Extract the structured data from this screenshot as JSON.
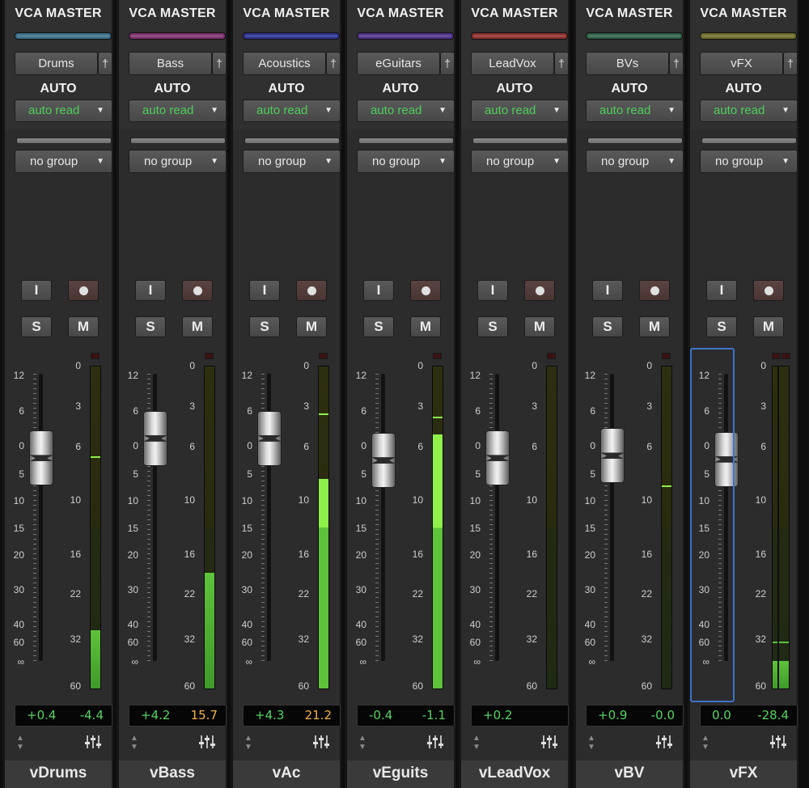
{
  "mixer_title": "",
  "strips": [
    {
      "header": "VCA MASTER",
      "color": "#3a6e86",
      "output": "Drums",
      "auto_label": "AUTO",
      "auto_mode": "auto read",
      "group": "no group",
      "input_btn": "I",
      "solo_btn": "S",
      "mute_btn": "M",
      "fader_db": "+0.4",
      "meter_readout": "-4.4",
      "meter_warn": false,
      "name": "vDrums",
      "meter_level": 0.18,
      "meter_peak": 0.715,
      "selected": false,
      "fader_pos": 0.245
    },
    {
      "header": "VCA MASTER",
      "color": "#7a2f6a",
      "output": "Bass",
      "auto_label": "AUTO",
      "auto_mode": "auto read",
      "group": "no group",
      "input_btn": "I",
      "solo_btn": "S",
      "mute_btn": "M",
      "fader_db": "+4.2",
      "meter_readout": "15.7",
      "meter_warn": true,
      "name": "vBass",
      "meter_level": 0.355,
      "meter_peak": 0.355,
      "selected": false,
      "fader_pos": 0.16
    },
    {
      "header": "VCA MASTER",
      "color": "#2c2f8c",
      "output": "Acoustics",
      "auto_label": "AUTO",
      "auto_mode": "auto read",
      "group": "no group",
      "input_btn": "I",
      "solo_btn": "S",
      "mute_btn": "M",
      "fader_db": "+4.3",
      "meter_readout": "21.2",
      "meter_warn": true,
      "name": "vAc",
      "meter_level": 0.65,
      "meter_peak": 0.85,
      "selected": false,
      "fader_pos": 0.16
    },
    {
      "header": "VCA MASTER",
      "color": "#4d2f86",
      "output": "eGuitars",
      "auto_label": "AUTO",
      "auto_mode": "auto read",
      "group": "no group",
      "input_btn": "I",
      "solo_btn": "S",
      "mute_btn": "M",
      "fader_db": "-0.4",
      "meter_readout": "-1.1",
      "meter_warn": false,
      "name": "vEguits",
      "meter_level": 0.79,
      "meter_peak": 0.84,
      "selected": false,
      "fader_pos": 0.255
    },
    {
      "header": "VCA MASTER",
      "color": "#8a2c2a",
      "output": "LeadVox",
      "auto_label": "AUTO",
      "auto_mode": "auto read",
      "group": "no group",
      "input_btn": "I",
      "solo_btn": "S",
      "mute_btn": "M",
      "fader_db": "+0.2",
      "meter_readout": "",
      "meter_warn": false,
      "name": "vLeadVox",
      "meter_level": 0.0,
      "meter_peak": 0.0,
      "selected": false,
      "fader_pos": 0.245
    },
    {
      "header": "VCA MASTER",
      "color": "#2e5e44",
      "output": "BVs",
      "auto_label": "AUTO",
      "auto_mode": "auto read",
      "group": "no group",
      "input_btn": "I",
      "solo_btn": "S",
      "mute_btn": "M",
      "fader_db": "+0.9",
      "meter_readout": "-0.0",
      "meter_warn": false,
      "name": "vBV",
      "meter_level": 0.0,
      "meter_peak": 0.625,
      "selected": false,
      "fader_pos": 0.235
    },
    {
      "header": "VCA MASTER",
      "color": "#6d6a2a",
      "output": "vFX",
      "auto_label": "AUTO",
      "auto_mode": "auto read",
      "group": "no group",
      "input_btn": "I",
      "solo_btn": "S",
      "mute_btn": "M",
      "fader_db": "0.0",
      "meter_readout": "-28.4",
      "meter_warn": false,
      "name": "vFX",
      "meter_level": 0.085,
      "meter_peak": 0.14,
      "selected": true,
      "fader_pos": 0.25,
      "stereo": true
    }
  ],
  "fader_scale": [
    "12",
    "6",
    "0",
    "5",
    "10",
    "15",
    "20",
    "30",
    "40",
    "60",
    "∞"
  ],
  "meter_scale": [
    "0",
    "3",
    "6",
    "10",
    "16",
    "22",
    "32",
    "60"
  ],
  "colors": {
    "green": "#4fce5a",
    "meter_green": "#5ec23a",
    "meter_bright": "#8ff04a",
    "warn": "#f2b24e",
    "select": "#3d74c8"
  },
  "icons": {
    "output_pin": "pin-icon",
    "dropdown": "chevron-down-icon",
    "record": "record-dot-icon",
    "updown": "up-down-arrows-icon",
    "mixer": "mixer-faders-icon"
  }
}
